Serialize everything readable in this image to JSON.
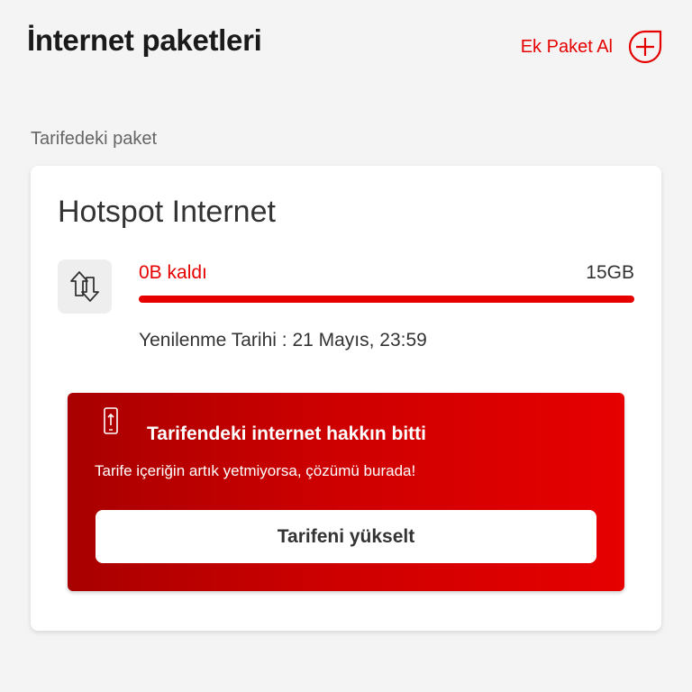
{
  "header": {
    "title": "İnternet paketleri",
    "add_package_label": "Ek Paket Al",
    "add_icon": "plus-circle-icon"
  },
  "section": {
    "label": "Tarifedeki paket"
  },
  "package": {
    "name": "Hotspot Internet",
    "icon": "data-transfer-arrows-icon",
    "remaining": "0B kaldı",
    "total": "15GB",
    "used_fraction": 1.0,
    "renewal": "Yenilenme Tarihi : 21 Mayıs, 23:59"
  },
  "alert": {
    "icon": "phone-upload-icon",
    "title": "Tarifendeki internet hakkın bitti",
    "text": "Tarife içeriğin artık yetmiyorsa, çözümü burada!",
    "button_label": "Tarifeni yükselt"
  },
  "colors": {
    "accent": "#e60000",
    "background": "#f4f4f4"
  }
}
